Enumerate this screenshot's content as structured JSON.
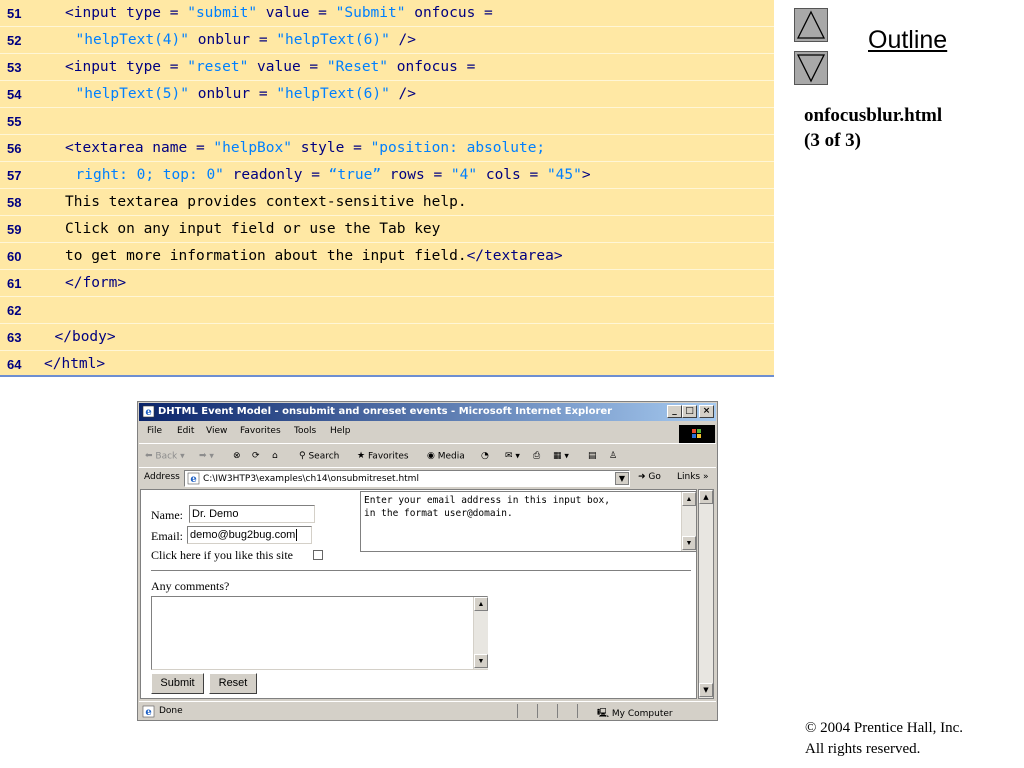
{
  "code": {
    "lines": [
      {
        "n": "51",
        "indent": 8,
        "tokens": [
          [
            "kw",
            "<input type = "
          ],
          [
            "str",
            "\"submit\""
          ],
          [
            "kw",
            " value = "
          ],
          [
            "str",
            "\"Submit\""
          ],
          [
            "kw",
            " onfocus ="
          ]
        ]
      },
      {
        "n": "52",
        "indent": 11,
        "tokens": [
          [
            "str",
            "\"helpText(4)\""
          ],
          [
            "kw",
            " onblur = "
          ],
          [
            "str",
            "\"helpText(6)\""
          ],
          [
            "kw",
            " />"
          ]
        ]
      },
      {
        "n": "53",
        "indent": 8,
        "tokens": [
          [
            "kw",
            "<input type = "
          ],
          [
            "str",
            "\"reset\""
          ],
          [
            "kw",
            " value = "
          ],
          [
            "str",
            "\"Reset\""
          ],
          [
            "kw",
            " onfocus ="
          ]
        ]
      },
      {
        "n": "54",
        "indent": 11,
        "tokens": [
          [
            "str",
            "\"helpText(5)\""
          ],
          [
            "kw",
            " onblur = "
          ],
          [
            "str",
            "\"helpText(6)\""
          ],
          [
            "kw",
            " />"
          ]
        ]
      },
      {
        "n": "55",
        "indent": 0,
        "tokens": []
      },
      {
        "n": "56",
        "indent": 8,
        "tokens": [
          [
            "kw",
            "<textarea name = "
          ],
          [
            "str",
            "\"helpBox\""
          ],
          [
            "kw",
            " style = "
          ],
          [
            "str",
            "\"position: absolute;"
          ]
        ]
      },
      {
        "n": "57",
        "indent": 11,
        "tokens": [
          [
            "str",
            "right: 0; top: 0\""
          ],
          [
            "kw",
            " readonly = "
          ],
          [
            "str",
            "“true”"
          ],
          [
            "kw",
            " rows = "
          ],
          [
            "str",
            "\"4\""
          ],
          [
            "kw",
            " cols = "
          ],
          [
            "str",
            "\"45\""
          ],
          [
            "kw",
            ">"
          ]
        ]
      },
      {
        "n": "58",
        "indent": 8,
        "tokens": [
          [
            "txt",
            "This textarea provides context-sensitive help."
          ]
        ]
      },
      {
        "n": "59",
        "indent": 8,
        "tokens": [
          [
            "txt",
            "Click on any input field or use the Tab key"
          ]
        ]
      },
      {
        "n": "60",
        "indent": 8,
        "tokens": [
          [
            "txt",
            "to get more information about the input field."
          ],
          [
            "kw",
            "</textarea>"
          ]
        ]
      },
      {
        "n": "61",
        "indent": 8,
        "tokens": [
          [
            "kw",
            "</form>"
          ]
        ]
      },
      {
        "n": "62",
        "indent": 0,
        "tokens": []
      },
      {
        "n": "63",
        "indent": 5,
        "tokens": [
          [
            "kw",
            "</body>"
          ]
        ]
      },
      {
        "n": "64",
        "indent": 2,
        "tokens": [
          [
            "kw",
            "</html>"
          ]
        ]
      }
    ]
  },
  "nav": {
    "outline_label": "Outline",
    "file_title_line1": "onfocusblur.html",
    "file_title_line2": "(3 of 3)"
  },
  "footer": {
    "copyright_line1": "© 2004 Prentice Hall, Inc.",
    "copyright_line2": "All rights reserved."
  },
  "browser": {
    "title": "DHTML Event Model - onsubmit and onreset events - Microsoft Internet Explorer",
    "menu": [
      "File",
      "Edit",
      "View",
      "Favorites",
      "Tools",
      "Help"
    ],
    "toolbar": {
      "back": "Back",
      "search": "Search",
      "favorites": "Favorites",
      "media": "Media"
    },
    "address_label": "Address",
    "address_value": "C:\\IW3HTP3\\examples\\ch14\\onsubmitreset.html",
    "go_label": "Go",
    "links_label": "Links »",
    "status_text": "Done",
    "status_zone": "My Computer",
    "icons": [
      "ie-page-icon",
      "back-arrow-icon",
      "forward-arrow-icon",
      "stop-icon",
      "refresh-icon",
      "home-icon",
      "search-icon",
      "favorites-icon",
      "media-icon",
      "history-icon",
      "mail-icon",
      "print-icon",
      "edit-icon",
      "discuss-icon",
      "messenger-icon",
      "computer-icon"
    ]
  },
  "form": {
    "name_label": "Name:",
    "name_value": "Dr. Demo",
    "email_label": "Email:",
    "email_value": "demo@bug2bug.com",
    "like_label": "Click here if you like this site",
    "comments_label": "Any comments?",
    "help_text": "Enter your email address in this input box,\nin the format user@domain.",
    "submit_label": "Submit",
    "reset_label": "Reset"
  },
  "colors": {
    "code_bg": "#ffe8a4",
    "code_keyword": "#000080",
    "code_string": "#0080ff",
    "window_chrome": "#d4d0c8",
    "titlebar": "#0a246a"
  }
}
